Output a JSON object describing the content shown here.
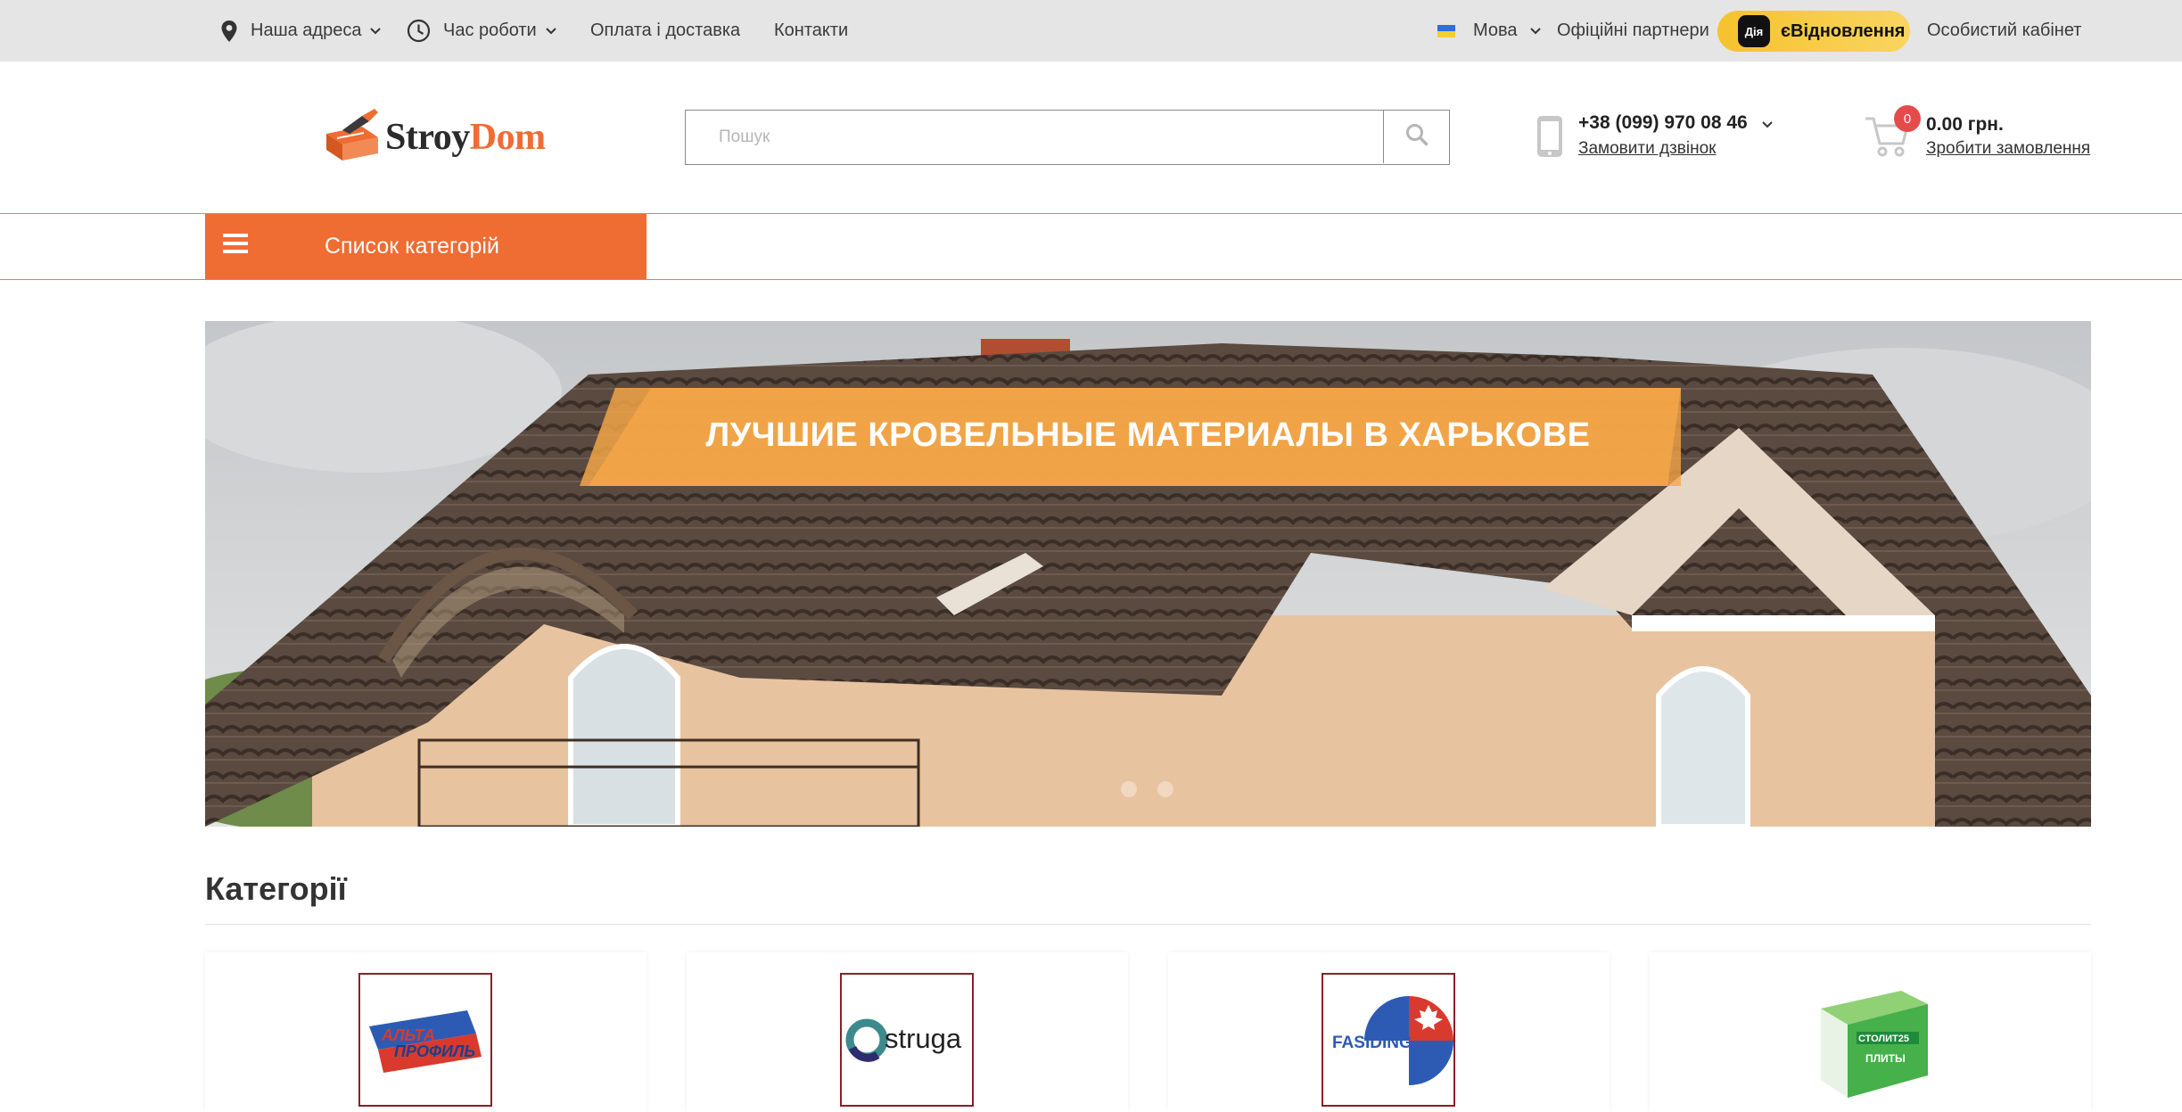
{
  "topbar": {
    "address_label": "Наша адреса",
    "hours_label": "Час роботи",
    "delivery_label": "Оплата і доставка",
    "contacts_label": "Контакти",
    "language_label": "Мова",
    "partners_label": "Офіційні партнери",
    "dia_logo": "Дія",
    "dia_label": "єВідновлення",
    "account_label": "Особистий кабінет"
  },
  "header": {
    "logo_part1": "Stroy",
    "logo_part2": "Dom",
    "search_placeholder": "Пошук",
    "phone": "+38 (099) 970 08 46",
    "callback_label": "Замовити дзвінок",
    "cart_count": "0",
    "cart_total": "0.00 грн.",
    "checkout_label": "Зробити замовлення"
  },
  "nav": {
    "categories_label": "Список категорій"
  },
  "banner": {
    "title": "ЛУЧШИЕ КРОВЕЛЬНЫЕ МАТЕРИАЛЫ В ХАРЬКОВЕ",
    "slide_count": 2
  },
  "categories": {
    "title": "Категорії",
    "items": [
      {
        "logo_text_1": "АЛЬТА",
        "logo_text_2": "ПРОФИЛЬ"
      },
      {
        "logo_text_1": "struga"
      },
      {
        "logo_text_1": "FASIDING"
      },
      {
        "logo_text_1": "СТОЛИТ25",
        "logo_text_2": "ПЛИТЫ"
      }
    ]
  },
  "colors": {
    "accent": "#ef6c33",
    "topbar_bg": "#e5e5e5",
    "dia_yellow": "#f6c22d",
    "badge_red": "#e54b4b"
  },
  "icons": [
    "location-pin-icon",
    "clock-icon",
    "chevron-down-icon",
    "ukraine-flag-icon",
    "search-icon",
    "phone-icon",
    "cart-icon",
    "hamburger-icon"
  ]
}
